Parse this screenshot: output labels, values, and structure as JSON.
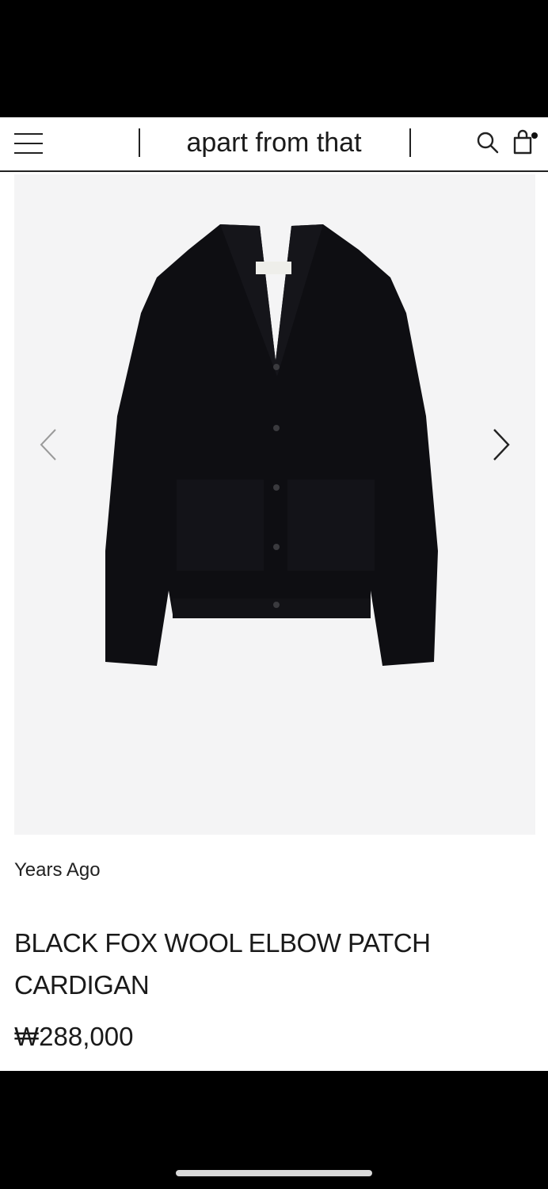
{
  "header": {
    "brand": "apart from that",
    "menu_icon": "hamburger-menu-icon",
    "search_icon": "search-icon",
    "bag_icon": "shopping-bag-icon"
  },
  "gallery": {
    "prev_icon": "chevron-left-icon",
    "next_icon": "chevron-right-icon",
    "image_alt": "Black wool cardigan",
    "label_text": "years ago"
  },
  "product": {
    "brand": "Years Ago",
    "title": "BLACK FOX WOOL ELBOW PATCH CARDIGAN",
    "price": "₩288,000"
  },
  "colors": {
    "background": "#ffffff",
    "gallery_bg": "#f4f4f5",
    "text": "#1a1a1a"
  }
}
